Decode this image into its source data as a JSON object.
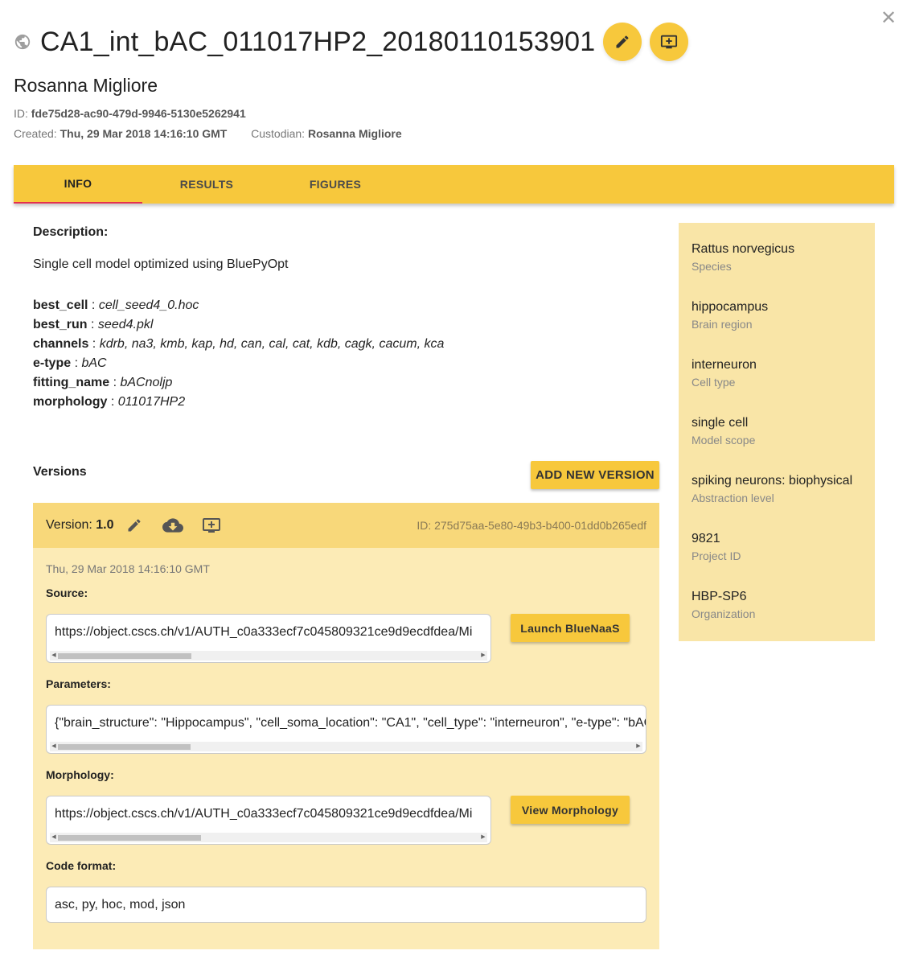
{
  "header": {
    "title": "CA1_int_bAC_011017HP2_20180110153901",
    "author": "Rosanna Migliore",
    "id_label": "ID:",
    "id_value": "fde75d28-ac90-479d-9946-5130e5262941",
    "created_label": "Created:",
    "created_value": "Thu, 29 Mar 2018 14:16:10 GMT",
    "custodian_label": "Custodian:",
    "custodian_value": "Rosanna Migliore",
    "close_symbol": "✕"
  },
  "tabs": [
    {
      "label": "INFO",
      "active": true
    },
    {
      "label": "RESULTS",
      "active": false
    },
    {
      "label": "FIGURES",
      "active": false
    }
  ],
  "info": {
    "description_label": "Description:",
    "description_text": "Single cell model optimized using BluePyOpt",
    "properties": [
      {
        "key": "best_cell",
        "value": "cell_seed4_0.hoc"
      },
      {
        "key": "best_run",
        "value": "seed4.pkl"
      },
      {
        "key": "channels",
        "value": "kdrb, na3, kmb, kap, hd, can, cal, cat, kdb, cagk, cacum, kca"
      },
      {
        "key": "e-type",
        "value": "bAC"
      },
      {
        "key": "fitting_name",
        "value": "bACnoljp"
      },
      {
        "key": "morphology",
        "value": "011017HP2"
      }
    ],
    "separator": " : "
  },
  "versions": {
    "label": "Versions",
    "add_button": "ADD NEW VERSION",
    "card": {
      "version_prefix": "Version:",
      "version_number": "1.0",
      "id_text": "ID: 275d75aa-5e80-49b3-b400-01dd0b265edf",
      "date": "Thu, 29 Mar 2018 14:16:10 GMT",
      "source_label": "Source:",
      "source_value": "https://object.cscs.ch/v1/AUTH_c0a333ecf7c045809321ce9d9ecdfdea/Mi",
      "launch_button": "Launch BlueNaaS",
      "parameters_label": "Parameters:",
      "parameters_value": "{\"brain_structure\": \"Hippocampus\", \"cell_soma_location\": \"CA1\", \"cell_type\": \"interneuron\", \"e-type\": \"bAC",
      "morphology_label": "Morphology:",
      "morphology_value": "https://object.cscs.ch/v1/AUTH_c0a333ecf7c045809321ce9d9ecdfdea/Mi",
      "view_morphology_button": "View Morphology",
      "code_format_label": "Code format:",
      "code_format_value": "asc, py, hoc, mod, json"
    }
  },
  "sidebar": [
    {
      "value": "Rattus norvegicus",
      "label": "Species"
    },
    {
      "value": "hippocampus",
      "label": "Brain region"
    },
    {
      "value": "interneuron",
      "label": "Cell type"
    },
    {
      "value": "single cell",
      "label": "Model scope"
    },
    {
      "value": "spiking neurons: biophysical",
      "label": "Abstraction level"
    },
    {
      "value": "9821",
      "label": "Project ID"
    },
    {
      "value": "HBP-SP6",
      "label": "Organization"
    }
  ],
  "colors": {
    "accent": "#f7c83c",
    "tab_indicator": "#e4304f",
    "card_header": "#f8d87a",
    "card_body": "#fcebb6",
    "sidebar": "#f9e5a7"
  }
}
